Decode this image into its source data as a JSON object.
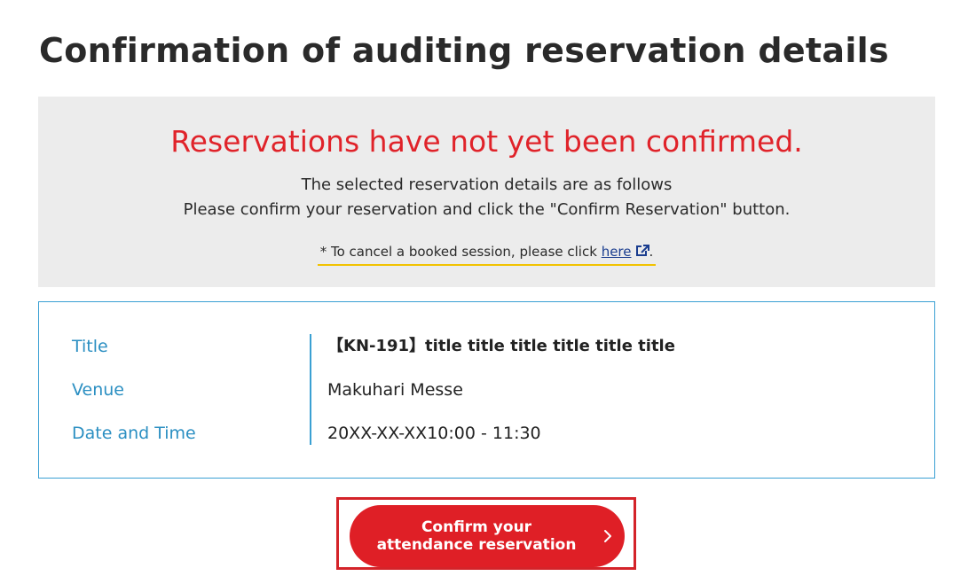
{
  "page": {
    "title": "Confirmation of auditing reservation details"
  },
  "notice": {
    "heading": "Reservations have not yet been confirmed.",
    "line1": "The selected reservation details are as follows",
    "line2": "Please confirm your reservation and click the \"Confirm Reservation\" button.",
    "cancel_prefix": "* To cancel a booked session, please click ",
    "cancel_link": "here",
    "cancel_suffix": ".",
    "external_icon": "external-link-icon"
  },
  "details": {
    "rows": [
      {
        "label": "Title",
        "value": "【KN-191】title title title title title title"
      },
      {
        "label": "Venue",
        "value": "Makuhari Messe"
      },
      {
        "label": "Date and Time",
        "value": "20XX-XX-XX10:00 - 11:30"
      }
    ]
  },
  "actions": {
    "confirm_label": "Confirm your attendance reservation",
    "confirm_icon": "chevron-right-icon"
  },
  "colors": {
    "accent_red": "#df1f26",
    "label_blue": "#2b8fc2",
    "border_blue": "#3aa0d3",
    "highlight_yellow": "#f2c200",
    "notice_bg": "#ececec"
  }
}
